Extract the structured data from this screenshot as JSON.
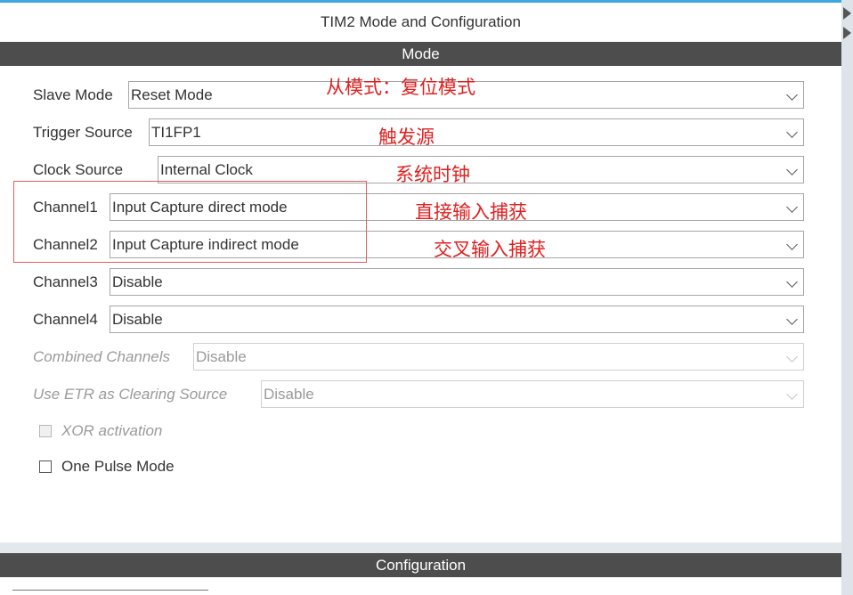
{
  "window": {
    "title": "TIM2 Mode and Configuration"
  },
  "sections": {
    "mode": "Mode",
    "configuration": "Configuration"
  },
  "fields": [
    {
      "label": "Slave Mode",
      "value": "Reset Mode",
      "enabled": true
    },
    {
      "label": "Trigger Source",
      "value": "TI1FP1",
      "enabled": true
    },
    {
      "label": "Clock Source",
      "value": "Internal Clock",
      "enabled": true
    },
    {
      "label": "Channel1",
      "value": "Input Capture direct mode",
      "enabled": true
    },
    {
      "label": "Channel2",
      "value": "Input Capture indirect mode",
      "enabled": true
    },
    {
      "label": "Channel3",
      "value": "Disable",
      "enabled": true
    },
    {
      "label": "Channel4",
      "value": "Disable",
      "enabled": true
    },
    {
      "label": "Combined Channels",
      "value": "Disable",
      "enabled": false
    },
    {
      "label": "Use ETR as Clearing Source",
      "value": "Disable",
      "enabled": false
    }
  ],
  "checkboxes": [
    {
      "label": "XOR activation",
      "checked": false,
      "enabled": false
    },
    {
      "label": "One Pulse Mode",
      "checked": false,
      "enabled": true
    }
  ],
  "annotations": [
    "从模式：复位模式",
    "触发源",
    "系统时钟",
    "直接输入捕获",
    "交叉输入捕获"
  ],
  "colors": {
    "accent": "#3ea7e0",
    "section_header": "#4d4d4d",
    "annotation": "#e02020"
  }
}
